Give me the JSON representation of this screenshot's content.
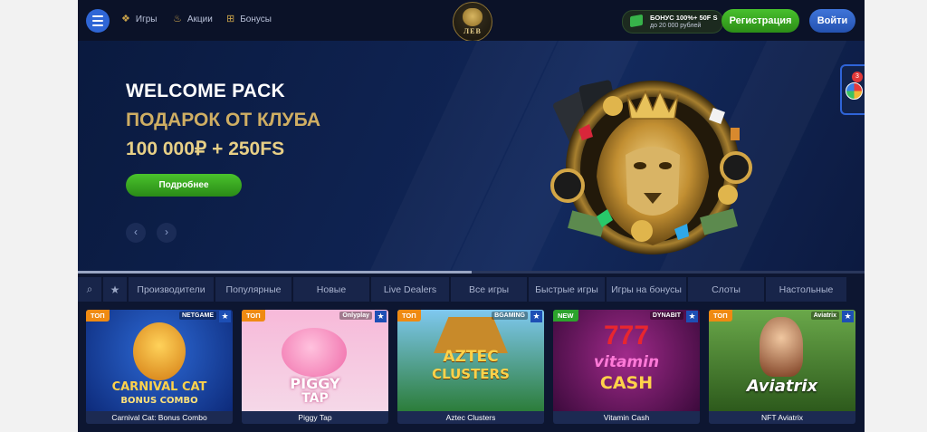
{
  "header": {
    "menu_icon": "hamburger-icon",
    "nav": [
      {
        "label": "Игры",
        "icon": "dice-icon"
      },
      {
        "label": "Акции",
        "icon": "fire-icon"
      },
      {
        "label": "Бонусы",
        "icon": "gift-icon"
      }
    ],
    "logo_text": "ЛЕВ",
    "bonus": {
      "line1": "БОНУС 100%+ 50F S",
      "line2": "до 20 000 рублей"
    },
    "register_label": "Регистрация",
    "login_label": "Войти"
  },
  "hero": {
    "title": "WELCOME PACK",
    "subtitle1": "ПОДАРОК ОТ КЛУБА",
    "subtitle2": "100 000₽ + 250FS",
    "button_label": "Подробнее",
    "prev_icon": "chevron-left-icon",
    "next_icon": "chevron-right-icon",
    "slide_progress": 0.5,
    "widget_badge": "3"
  },
  "filters": {
    "search_icon": "search-icon",
    "favorites_icon": "star-icon",
    "tabs": [
      "Производители",
      "Популярные",
      "Новые",
      "Live Dealers",
      "Все игры",
      "Быстрые игры",
      "Игры на бонусы",
      "Слоты",
      "Настольные"
    ]
  },
  "games": [
    {
      "name": "Carnival Cat: Bonus Combo",
      "tag": "ТОП",
      "provider": "NETGAME",
      "art_line1": "CARNIVAL CAT",
      "art_line2": "BONUS COMBO"
    },
    {
      "name": "Piggy Tap",
      "tag": "ТОП",
      "provider": "Onlyplay",
      "art_line1": "PIGGY",
      "art_line2": "TAP"
    },
    {
      "name": "Aztec Clusters",
      "tag": "ТОП",
      "provider": "BGAMING",
      "art_line1": "AZTEC",
      "art_line2": "CLUSTERS"
    },
    {
      "name": "Vitamin Cash",
      "tag": "NEW",
      "provider": "DYNABIT",
      "art_line1": "vitamin",
      "art_line2": "CASH"
    },
    {
      "name": "NFT Aviatrix",
      "tag": "ТОП",
      "provider": "Aviatrix",
      "art_line1": "Aviatrix",
      "art_line2": ""
    }
  ]
}
